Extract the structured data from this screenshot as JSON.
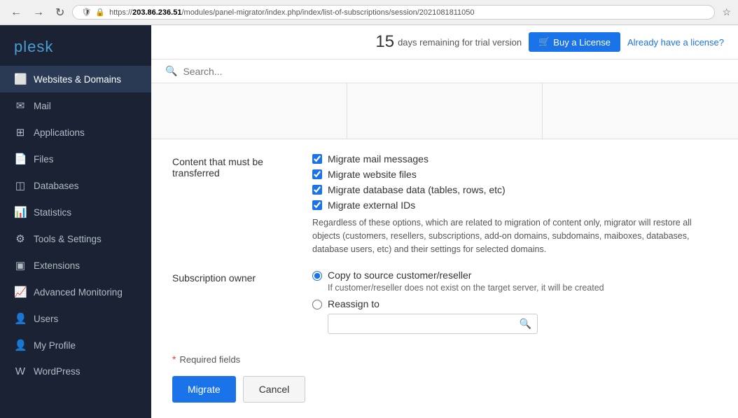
{
  "browser": {
    "back_title": "Back",
    "forward_title": "Forward",
    "refresh_title": "Refresh",
    "url_display": "https://203.86.236.51/modules/panel-migrator/index.php/index/list-of-subscriptions/session/2021081811050",
    "url_bold": "203.86.236.51",
    "url_path": "/modules/panel-migrator/index.php/index/list-of-subscriptions/session/2021081811050"
  },
  "top_banner": {
    "trial_days": "15",
    "trial_text": "days remaining for trial version",
    "buy_license_label": "Buy a License",
    "already_license_label": "Already have a license?"
  },
  "search": {
    "placeholder": "Search..."
  },
  "sidebar": {
    "logo": "plesk",
    "items": [
      {
        "id": "websites-domains",
        "label": "Websites & Domains",
        "icon": "🌐",
        "active": true
      },
      {
        "id": "mail",
        "label": "Mail",
        "icon": "✉"
      },
      {
        "id": "applications",
        "label": "Applications",
        "icon": "⊞"
      },
      {
        "id": "files",
        "label": "Files",
        "icon": "📄"
      },
      {
        "id": "databases",
        "label": "Databases",
        "icon": "🗄"
      },
      {
        "id": "statistics",
        "label": "Statistics",
        "icon": "📊"
      },
      {
        "id": "tools-settings",
        "label": "Tools & Settings",
        "icon": "⚙"
      },
      {
        "id": "extensions",
        "label": "Extensions",
        "icon": "⊡"
      },
      {
        "id": "advanced-monitoring",
        "label": "Advanced Monitoring",
        "icon": "📈"
      },
      {
        "id": "users",
        "label": "Users",
        "icon": "👤"
      },
      {
        "id": "my-profile",
        "label": "My Profile",
        "icon": "👤"
      },
      {
        "id": "wordpress",
        "label": "WordPress",
        "icon": "W"
      }
    ]
  },
  "form": {
    "content_label": "Content that must be transferred",
    "checkboxes": [
      {
        "id": "migrate-mail",
        "label": "Migrate mail messages",
        "checked": true
      },
      {
        "id": "migrate-website",
        "label": "Migrate website files",
        "checked": true
      },
      {
        "id": "migrate-database",
        "label": "Migrate database data (tables, rows, etc)",
        "checked": true
      },
      {
        "id": "migrate-external",
        "label": "Migrate external IDs",
        "checked": true
      }
    ],
    "help_text": "Regardless of these options, which are related to migration of content only, migrator will restore all objects (customers, resellers, subscriptions, add-on domains, subdomains, maiboxes, databases, database users, etc) and their settings for selected domains.",
    "subscription_owner_label": "Subscription owner",
    "radio_options": [
      {
        "id": "copy-source",
        "label": "Copy to source customer/reseller",
        "sublabel": "If customer/reseller does not exist on the target server, it will be created",
        "checked": true
      },
      {
        "id": "reassign-to",
        "label": "Reassign to",
        "sublabel": "",
        "checked": false
      }
    ],
    "search_placeholder": "",
    "required_label": "Required fields",
    "migrate_btn": "Migrate",
    "cancel_btn": "Cancel"
  }
}
